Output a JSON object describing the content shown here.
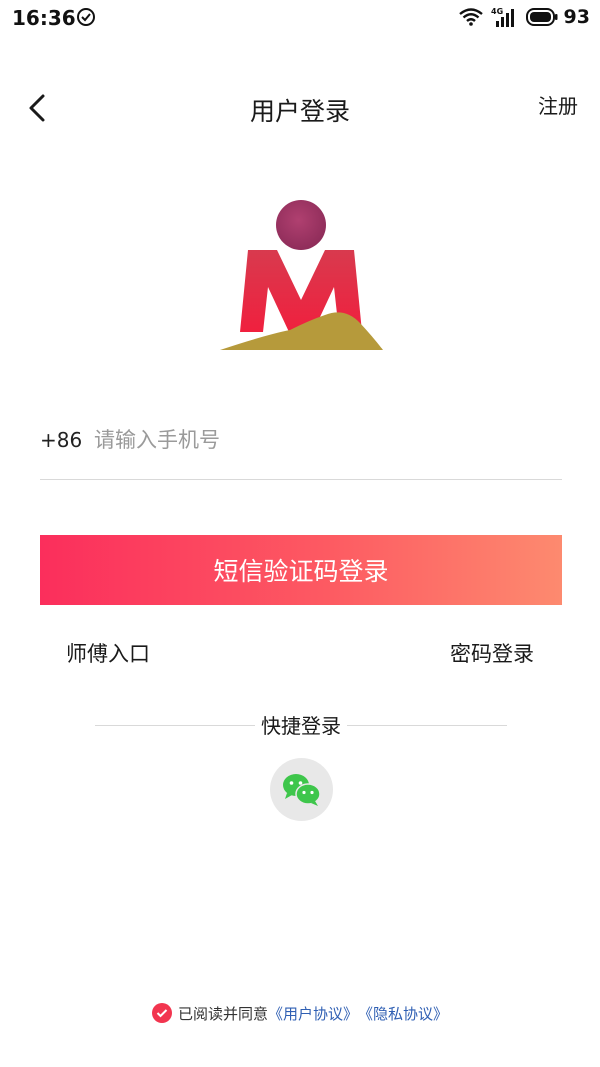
{
  "status_bar": {
    "time": "16:36",
    "network": "4G",
    "battery": "93"
  },
  "header": {
    "title": "用户登录",
    "register_label": "注册"
  },
  "logo": {
    "icon": "m-logo"
  },
  "phone": {
    "country_code": "+86",
    "placeholder": "请输入手机号",
    "value": ""
  },
  "sms_button_label": "短信验证码登录",
  "links": {
    "master_entry": "师傅入口",
    "password_login": "密码登录"
  },
  "quick_login": {
    "label": "快捷登录",
    "wechat_icon": "wechat-icon"
  },
  "agreement": {
    "prefix": "已阅读并同意",
    "user_agreement": "《用户协议》",
    "privacy_policy": "《隐私协议》"
  },
  "colors": {
    "primary_gradient_start": "#fb2e5c",
    "primary_gradient_end": "#fd8a6f",
    "link_blue": "#2f5fb3",
    "wechat_green": "#3ec64b"
  }
}
